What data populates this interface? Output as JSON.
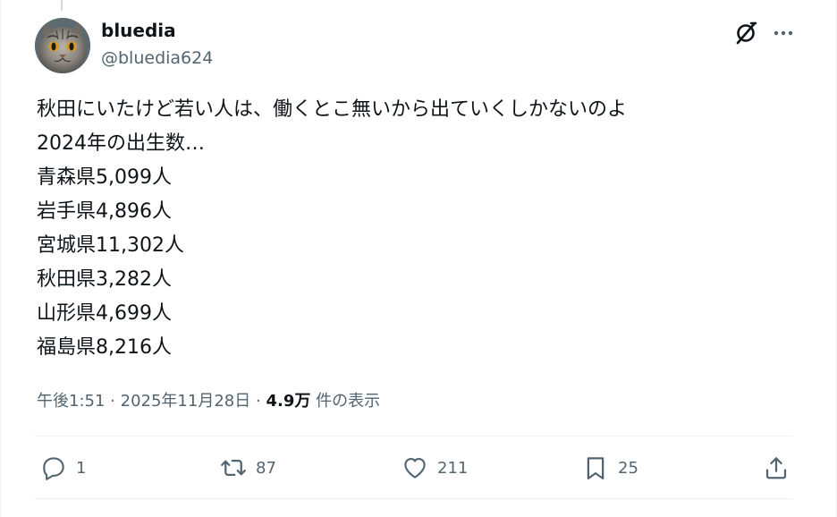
{
  "author": {
    "display_name": "bluedia",
    "handle": "@bluedia624",
    "avatar_icon": "cat-avatar"
  },
  "tweet": {
    "lines": [
      "秋田にいたけど若い人は、働くとこ無いから出ていくしかないのよ",
      "2024年の出生数…",
      "青森県5,099人",
      "岩手県4,896人",
      "宮城県11,302人",
      "秋田県3,282人",
      "山形県4,699人",
      "福島県8,216人"
    ]
  },
  "meta": {
    "time": "午後1:51",
    "separator": "·",
    "date": "2025年11月28日",
    "views_count": "4.9万",
    "views_label": "件の表示"
  },
  "actions": {
    "reply_count": "1",
    "retweet_count": "87",
    "like_count": "211",
    "bookmark_count": "25"
  },
  "icons": {
    "grok": "grok-icon",
    "more": "more-icon",
    "reply": "reply-icon",
    "retweet": "retweet-icon",
    "like": "heart-icon",
    "bookmark": "bookmark-icon",
    "share": "share-icon"
  },
  "colors": {
    "text_primary": "#0f1419",
    "text_secondary": "#536471",
    "divider": "#eff3f4"
  }
}
